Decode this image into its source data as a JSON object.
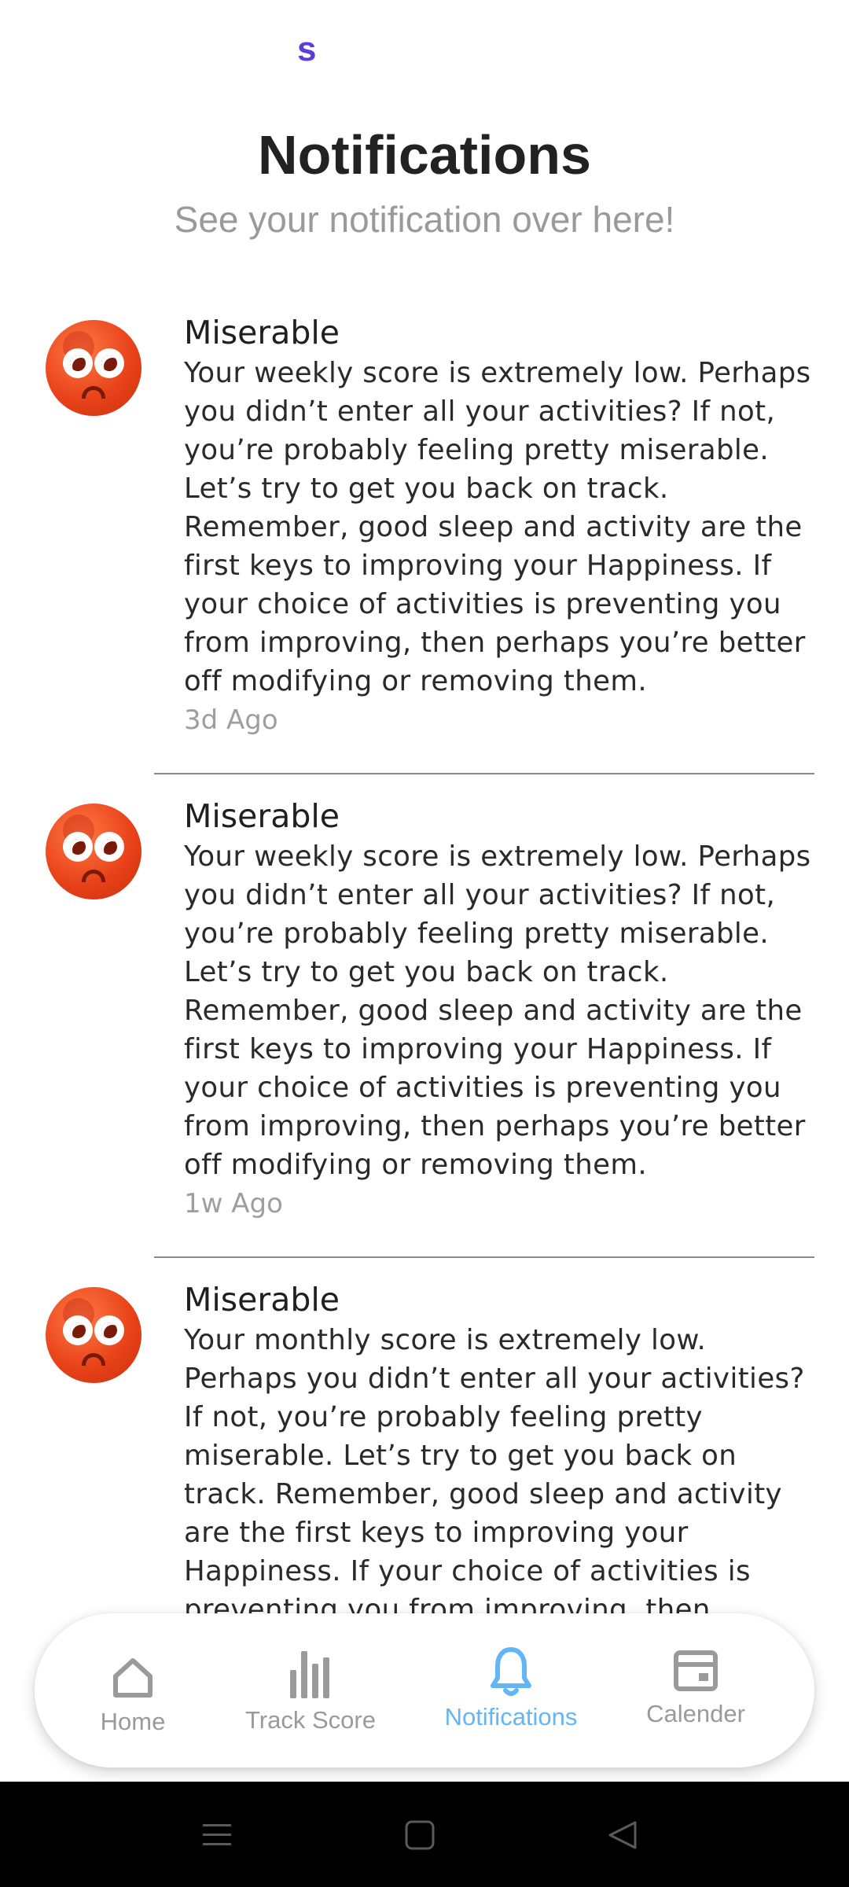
{
  "app": {
    "logo_text": "s",
    "brand_color": "#5a3ddb"
  },
  "header": {
    "title": "Notifications",
    "subtitle": "See your notification over here!"
  },
  "notifications": [
    {
      "icon": "miserable-face-icon",
      "title": "Miserable",
      "body": "Your weekly score is extremely low. Perhaps you didn’t enter all your activities? If not, you’re probably feeling pretty miserable. Let’s try to get you back on track. Remember, good sleep and activity are the first keys to improving your Happiness. If your choice of activities is preventing you from improving, then perhaps you’re better off modifying or removing them.",
      "time": "3d Ago"
    },
    {
      "icon": "miserable-face-icon",
      "title": "Miserable",
      "body": "Your weekly score is extremely low. Perhaps you didn’t enter all your activities? If not, you’re probably feeling pretty miserable. Let’s try to get you back on track. Remember, good sleep and activity are the first keys to improving your Happiness. If your choice of activities is preventing you from improving, then perhaps you’re better off modifying or removing them.",
      "time": "1w Ago"
    },
    {
      "icon": "miserable-face-icon",
      "title": "Miserable",
      "body": "Your monthly score is extremely low. Perhaps you didn’t enter all your activities? If not, you’re probably feeling pretty miserable. Let’s try to get you back on track. Remember, good sleep and activity are the first keys to improving your Happiness. If your choice of activities is preventing you from improving, then perhaps you’re better",
      "time": ""
    }
  ],
  "bottom_nav": {
    "active_color": "#64b5f6",
    "items": [
      {
        "label": "Home",
        "icon": "home-icon",
        "active": false
      },
      {
        "label": "Track Score",
        "icon": "bar-chart-icon",
        "active": false
      },
      {
        "label": "Notifications",
        "icon": "bell-icon",
        "active": true
      },
      {
        "label": "Calender",
        "icon": "calendar-icon",
        "active": false
      }
    ]
  },
  "system_nav": {
    "icons": [
      "menu-icon",
      "home-square-icon",
      "back-icon"
    ]
  }
}
